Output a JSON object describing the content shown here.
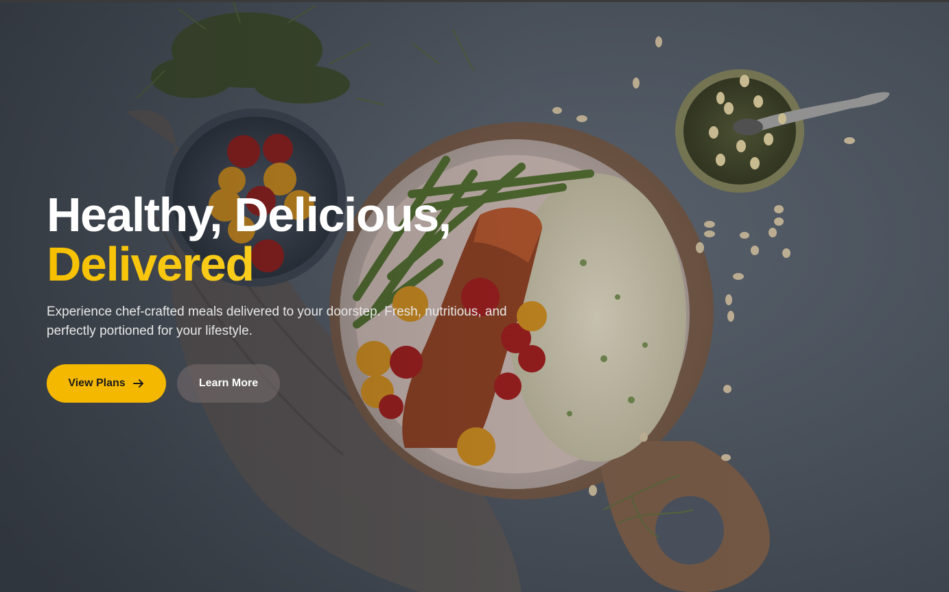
{
  "hero": {
    "title_line1": "Healthy, Delicious,",
    "title_line2": "Delivered",
    "subtitle": "Experience chef-crafted meals delivered to your doorstep. Fresh, nutritious, and perfectly portioned for your lifestyle.",
    "primary_button": "View Plans",
    "secondary_button": "Learn More",
    "primary_icon": "arrow-right-icon"
  },
  "colors": {
    "accent": "#f5b800",
    "accent_gradient_end": "#fde56a",
    "secondary_button_bg": "#786e6e",
    "overlay": "#2e3238"
  },
  "background": {
    "image": "food-photo",
    "elements": [
      "microgreens",
      "cherry-tomato-bowl",
      "linen-napkin",
      "wooden-board",
      "salmon-plate",
      "pesto-bowl",
      "spoon",
      "pine-nuts"
    ]
  }
}
